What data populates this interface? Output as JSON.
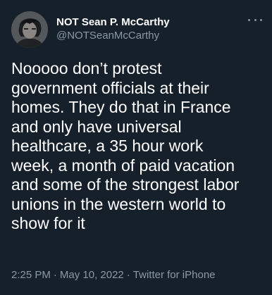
{
  "tweet": {
    "author": {
      "display_name": "NOT Sean P. McCarthy",
      "handle": "@NOTSeanMcCarthy",
      "avatar_icon": "profile-photo"
    },
    "more_icon": "ellipsis-icon",
    "text": "Nooooo don’t protest\ngovernment officials at their\nhomes. They do that in France\nand only have universal\nhealthcare, a 35 hour work\nweek, a month of paid vacation\nand some of the strongest labor\nunions in the western world to\nshow for it",
    "time": "2:25 PM",
    "date": "May 10, 2022",
    "source": "Twitter for iPhone",
    "separator": "·"
  },
  "colors": {
    "background": "#15202b",
    "primary_text": "#ffffff",
    "secondary_text": "#8b98a5"
  }
}
